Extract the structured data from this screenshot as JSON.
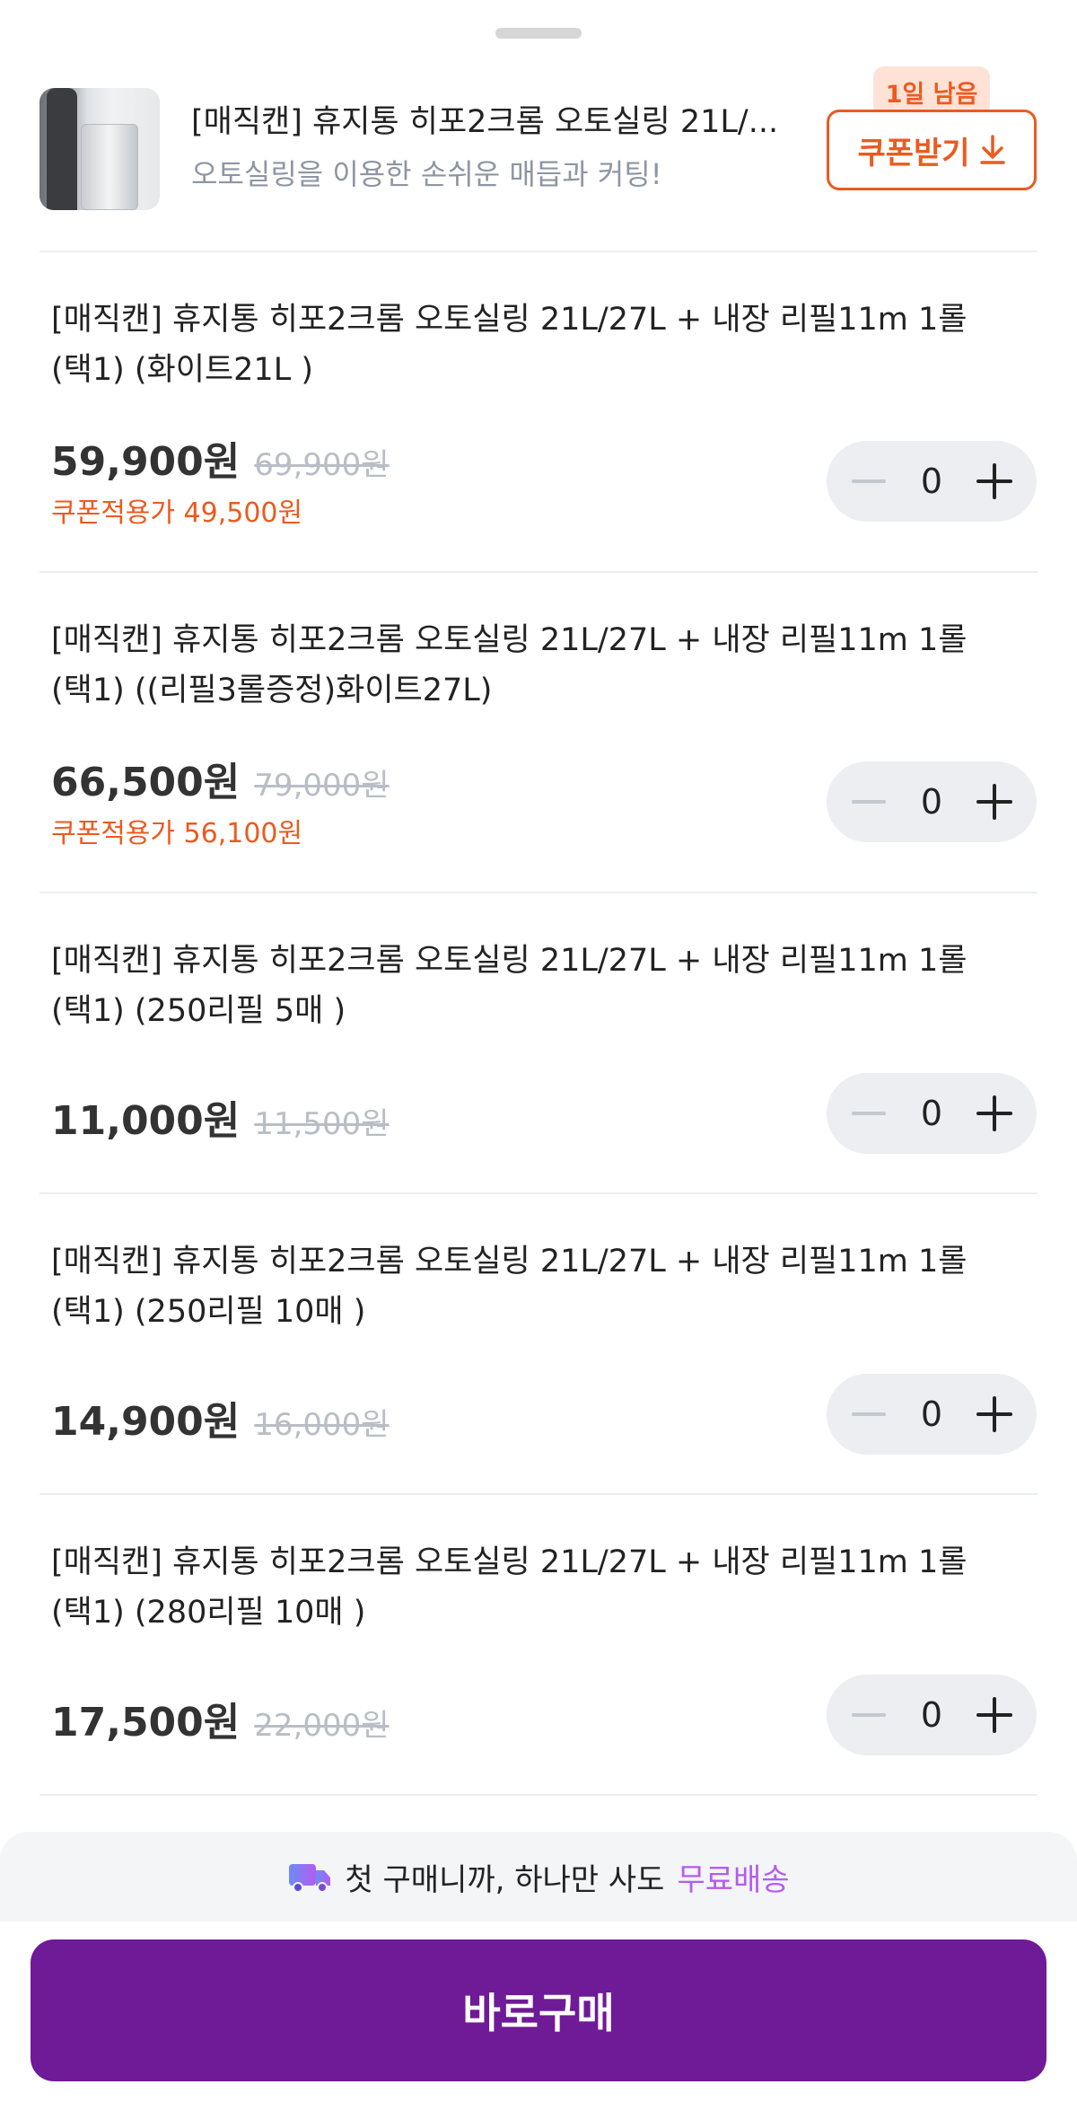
{
  "header": {
    "title": "[매직캔] 휴지통 히포2크롬 오토실링 21L/...",
    "subtitle": "오토실링을 이용한 손쉬운 매듭과 커팅!",
    "coupon_badge": "1일 남음",
    "coupon_button": "쿠폰받기"
  },
  "items": [
    {
      "name": "[매직캔] 휴지통 히포2크롬 오토실링 21L/27L + 내장 리필11m 1롤 (택1) (화이트21L )",
      "price": "59,900원",
      "original_price": "69,900원",
      "coupon_price": "쿠폰적용가 49,500원",
      "quantity": "0"
    },
    {
      "name": "[매직캔] 휴지통 히포2크롬 오토실링 21L/27L + 내장 리필11m 1롤 (택1) ((리필3롤증정)화이트27L)",
      "price": "66,500원",
      "original_price": "79,000원",
      "coupon_price": "쿠폰적용가 56,100원",
      "quantity": "0"
    },
    {
      "name": "[매직캔] 휴지통 히포2크롬 오토실링 21L/27L + 내장 리필11m 1롤 (택1) (250리필 5매 )",
      "price": "11,000원",
      "original_price": "11,500원",
      "quantity": "0"
    },
    {
      "name": "[매직캔] 휴지통 히포2크롬 오토실링 21L/27L + 내장 리필11m 1롤 (택1) (250리필 10매 )",
      "price": "14,900원",
      "original_price": "16,000원",
      "quantity": "0"
    },
    {
      "name": "[매직캔] 휴지통 히포2크롬 오토실링 21L/27L + 내장 리필11m 1롤 (택1) (280리필 10매 )",
      "price": "17,500원",
      "original_price": "22,000원",
      "quantity": "0"
    }
  ],
  "promo": {
    "text": "첫 구매니까, 하나만 사도",
    "highlight": "무료배송"
  },
  "buy_button": "바로구매",
  "colors": {
    "accent_orange": "#ec5a1f",
    "brand_purple": "#6f1a96",
    "free_shipping": "#b45cf0"
  },
  "icons": [
    "download-icon",
    "minus-icon",
    "plus-icon",
    "truck-icon"
  ]
}
